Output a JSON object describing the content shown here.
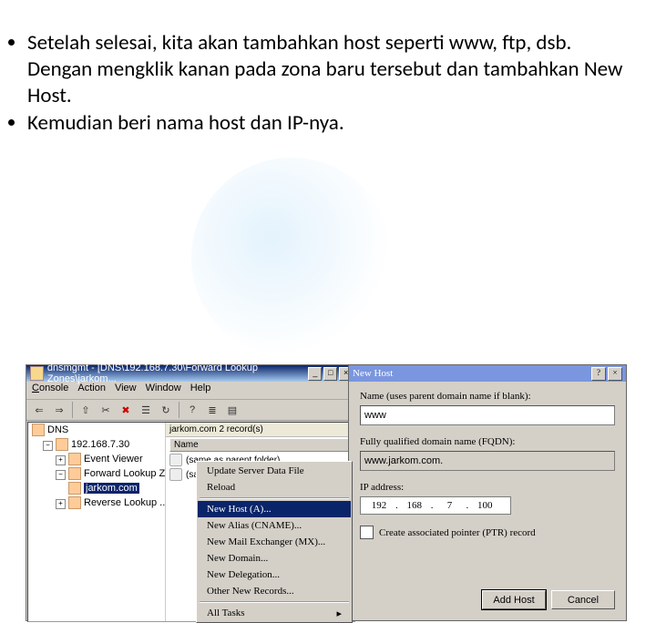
{
  "bullets": [
    "Setelah selesai, kita akan tambahkan host seperti www, ftp, dsb. Dengan mengklik kanan pada zona baru tersebut dan tambahkan New Host.",
    "Kemudian beri nama host dan IP-nya."
  ],
  "mmc": {
    "title": "dnsmgmt - [DNS\\192.168.7.30\\Forward Lookup Zones\\jarkom...",
    "menu": {
      "console": "Console",
      "action": "Action",
      "view": "View",
      "window": "Window",
      "help": "Help"
    },
    "tree": {
      "root": "DNS",
      "server": "192.168.7.30",
      "event": "Event Viewer",
      "fwd": "Forward Lookup Zones",
      "zone": "jarkom.com",
      "rev": "Reverse Lookup ..."
    },
    "list": {
      "header": "jarkom.com  2 record(s)",
      "col_name": "Name",
      "r1": "(same as parent folder)",
      "r2": "(same as parent folder)"
    }
  },
  "ctx": {
    "update": "Update Server Data File",
    "reload": "Reload",
    "newhost": "New Host (A)...",
    "alias": "New Alias (CNAME)...",
    "mx": "New Mail Exchanger (MX)...",
    "domain": "New Domain...",
    "delegation": "New Delegation...",
    "other": "Other New Records...",
    "alltasks": "All Tasks"
  },
  "dlg": {
    "title": "New Host",
    "name_lbl": "Name (uses parent domain name if blank):",
    "name_val": "www",
    "fqdn_lbl": "Fully qualified domain name (FQDN):",
    "fqdn_val": "www.jarkom.com.",
    "ip_lbl": "IP address:",
    "ip": {
      "a": "192",
      "b": "168",
      "c": "7",
      "d": "100"
    },
    "ptr_lbl": "Create associated pointer (PTR) record",
    "add": "Add Host",
    "cancel": "Cancel"
  }
}
